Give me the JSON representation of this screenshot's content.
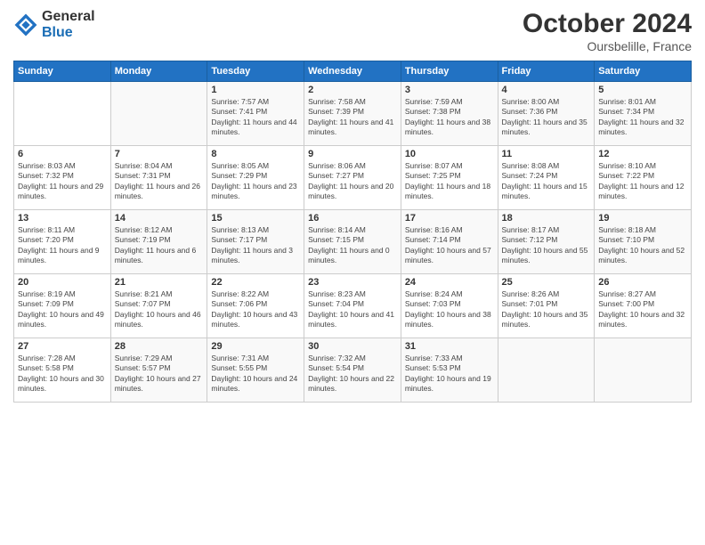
{
  "header": {
    "logo_general": "General",
    "logo_blue": "Blue",
    "month_title": "October 2024",
    "subtitle": "Oursbelille, France"
  },
  "days_of_week": [
    "Sunday",
    "Monday",
    "Tuesday",
    "Wednesday",
    "Thursday",
    "Friday",
    "Saturday"
  ],
  "weeks": [
    [
      {
        "day": "",
        "info": ""
      },
      {
        "day": "",
        "info": ""
      },
      {
        "day": "1",
        "info": "Sunrise: 7:57 AM\nSunset: 7:41 PM\nDaylight: 11 hours and 44 minutes."
      },
      {
        "day": "2",
        "info": "Sunrise: 7:58 AM\nSunset: 7:39 PM\nDaylight: 11 hours and 41 minutes."
      },
      {
        "day": "3",
        "info": "Sunrise: 7:59 AM\nSunset: 7:38 PM\nDaylight: 11 hours and 38 minutes."
      },
      {
        "day": "4",
        "info": "Sunrise: 8:00 AM\nSunset: 7:36 PM\nDaylight: 11 hours and 35 minutes."
      },
      {
        "day": "5",
        "info": "Sunrise: 8:01 AM\nSunset: 7:34 PM\nDaylight: 11 hours and 32 minutes."
      }
    ],
    [
      {
        "day": "6",
        "info": "Sunrise: 8:03 AM\nSunset: 7:32 PM\nDaylight: 11 hours and 29 minutes."
      },
      {
        "day": "7",
        "info": "Sunrise: 8:04 AM\nSunset: 7:31 PM\nDaylight: 11 hours and 26 minutes."
      },
      {
        "day": "8",
        "info": "Sunrise: 8:05 AM\nSunset: 7:29 PM\nDaylight: 11 hours and 23 minutes."
      },
      {
        "day": "9",
        "info": "Sunrise: 8:06 AM\nSunset: 7:27 PM\nDaylight: 11 hours and 20 minutes."
      },
      {
        "day": "10",
        "info": "Sunrise: 8:07 AM\nSunset: 7:25 PM\nDaylight: 11 hours and 18 minutes."
      },
      {
        "day": "11",
        "info": "Sunrise: 8:08 AM\nSunset: 7:24 PM\nDaylight: 11 hours and 15 minutes."
      },
      {
        "day": "12",
        "info": "Sunrise: 8:10 AM\nSunset: 7:22 PM\nDaylight: 11 hours and 12 minutes."
      }
    ],
    [
      {
        "day": "13",
        "info": "Sunrise: 8:11 AM\nSunset: 7:20 PM\nDaylight: 11 hours and 9 minutes."
      },
      {
        "day": "14",
        "info": "Sunrise: 8:12 AM\nSunset: 7:19 PM\nDaylight: 11 hours and 6 minutes."
      },
      {
        "day": "15",
        "info": "Sunrise: 8:13 AM\nSunset: 7:17 PM\nDaylight: 11 hours and 3 minutes."
      },
      {
        "day": "16",
        "info": "Sunrise: 8:14 AM\nSunset: 7:15 PM\nDaylight: 11 hours and 0 minutes."
      },
      {
        "day": "17",
        "info": "Sunrise: 8:16 AM\nSunset: 7:14 PM\nDaylight: 10 hours and 57 minutes."
      },
      {
        "day": "18",
        "info": "Sunrise: 8:17 AM\nSunset: 7:12 PM\nDaylight: 10 hours and 55 minutes."
      },
      {
        "day": "19",
        "info": "Sunrise: 8:18 AM\nSunset: 7:10 PM\nDaylight: 10 hours and 52 minutes."
      }
    ],
    [
      {
        "day": "20",
        "info": "Sunrise: 8:19 AM\nSunset: 7:09 PM\nDaylight: 10 hours and 49 minutes."
      },
      {
        "day": "21",
        "info": "Sunrise: 8:21 AM\nSunset: 7:07 PM\nDaylight: 10 hours and 46 minutes."
      },
      {
        "day": "22",
        "info": "Sunrise: 8:22 AM\nSunset: 7:06 PM\nDaylight: 10 hours and 43 minutes."
      },
      {
        "day": "23",
        "info": "Sunrise: 8:23 AM\nSunset: 7:04 PM\nDaylight: 10 hours and 41 minutes."
      },
      {
        "day": "24",
        "info": "Sunrise: 8:24 AM\nSunset: 7:03 PM\nDaylight: 10 hours and 38 minutes."
      },
      {
        "day": "25",
        "info": "Sunrise: 8:26 AM\nSunset: 7:01 PM\nDaylight: 10 hours and 35 minutes."
      },
      {
        "day": "26",
        "info": "Sunrise: 8:27 AM\nSunset: 7:00 PM\nDaylight: 10 hours and 32 minutes."
      }
    ],
    [
      {
        "day": "27",
        "info": "Sunrise: 7:28 AM\nSunset: 5:58 PM\nDaylight: 10 hours and 30 minutes."
      },
      {
        "day": "28",
        "info": "Sunrise: 7:29 AM\nSunset: 5:57 PM\nDaylight: 10 hours and 27 minutes."
      },
      {
        "day": "29",
        "info": "Sunrise: 7:31 AM\nSunset: 5:55 PM\nDaylight: 10 hours and 24 minutes."
      },
      {
        "day": "30",
        "info": "Sunrise: 7:32 AM\nSunset: 5:54 PM\nDaylight: 10 hours and 22 minutes."
      },
      {
        "day": "31",
        "info": "Sunrise: 7:33 AM\nSunset: 5:53 PM\nDaylight: 10 hours and 19 minutes."
      },
      {
        "day": "",
        "info": ""
      },
      {
        "day": "",
        "info": ""
      }
    ]
  ]
}
